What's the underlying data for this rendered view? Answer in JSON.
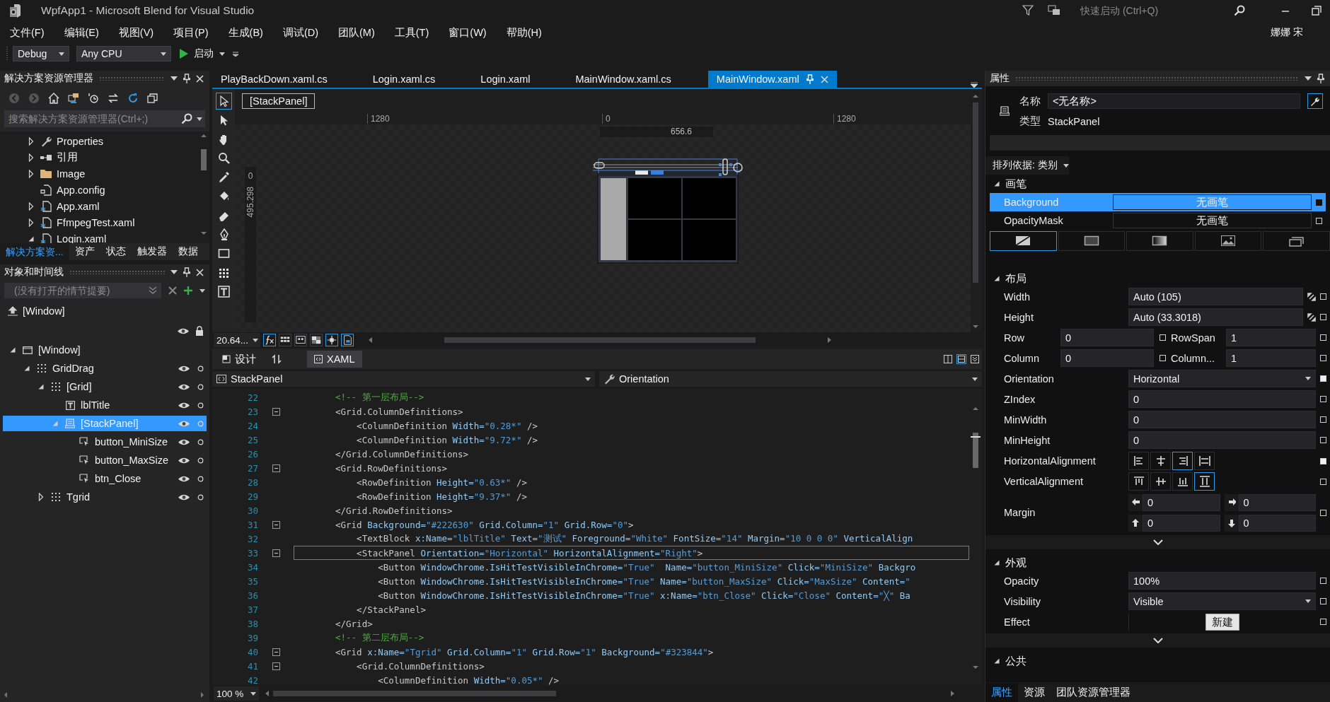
{
  "window": {
    "title": "WpfApp1 - Microsoft Blend for Visual Studio",
    "quick_launch": {
      "placeholder": "快速启动 (Ctrl+Q)"
    },
    "user": "娜娜 宋"
  },
  "menu": [
    "文件(F)",
    "编辑(E)",
    "视图(V)",
    "项目(P)",
    "生成(B)",
    "调试(D)",
    "团队(M)",
    "工具(T)",
    "窗口(W)",
    "帮助(H)"
  ],
  "toolbar": {
    "configuration": "Debug",
    "platform": "Any CPU",
    "start": "启动"
  },
  "solution_explorer": {
    "title": "解决方案资源管理器",
    "search": {
      "placeholder": "搜索解决方案资源管理器(Ctrl+;)"
    },
    "items": [
      {
        "label": "Properties",
        "kind": "wrench",
        "expanded": false
      },
      {
        "label": "引用",
        "kind": "references",
        "expanded": false
      },
      {
        "label": "Image",
        "kind": "folder",
        "expanded": false
      },
      {
        "label": "App.config",
        "kind": "config"
      },
      {
        "label": "App.xaml",
        "kind": "xaml",
        "expanded": false
      },
      {
        "label": "FfmpegTest.xaml",
        "kind": "xaml",
        "expanded": false
      },
      {
        "label": "Login.xaml",
        "kind": "xaml",
        "expanded": true
      }
    ],
    "tabs": [
      {
        "label": "解决方案资...",
        "selected": true
      },
      {
        "label": "资产",
        "selected": false
      },
      {
        "label": "状态",
        "selected": false
      },
      {
        "label": "触发器",
        "selected": false
      },
      {
        "label": "数据",
        "selected": false
      }
    ]
  },
  "objects": {
    "title": "对象和时间线",
    "storyboard": {
      "placeholder": "(没有打开的情节提要)"
    },
    "scope": "[Window]",
    "tree": [
      {
        "label": "[Window]",
        "kind": "window",
        "expanded": true,
        "selected": false,
        "children": [
          {
            "label": "GridDrag",
            "kind": "grid",
            "expanded": true,
            "selected": false,
            "children": [
              {
                "label": "[Grid]",
                "kind": "grid",
                "expanded": true,
                "selected": false,
                "children": [
                  {
                    "label": "lblTitle",
                    "kind": "text",
                    "selected": false
                  },
                  {
                    "label": "[StackPanel]",
                    "kind": "stack",
                    "expanded": true,
                    "selected": true,
                    "children": [
                      {
                        "label": "button_MiniSize",
                        "kind": "button",
                        "selected": false
                      },
                      {
                        "label": "button_MaxSize",
                        "kind": "button",
                        "selected": false
                      },
                      {
                        "label": "btn_Close",
                        "kind": "button",
                        "selected": false
                      }
                    ]
                  }
                ]
              },
              {
                "label": "Tgrid",
                "kind": "grid",
                "expanded": false,
                "selected": false
              }
            ]
          }
        ]
      }
    ]
  },
  "editor": {
    "tabs": [
      {
        "label": "PlayBackDown.xaml.cs",
        "selected": false
      },
      {
        "label": "Login.xaml.cs",
        "selected": false
      },
      {
        "label": "Login.xaml",
        "selected": false
      },
      {
        "label": "MainWindow.xaml.cs",
        "selected": false
      },
      {
        "label": "MainWindow.xaml",
        "selected": true
      }
    ],
    "designer": {
      "breadcrumb": "[StackPanel]",
      "ruler_labels": [
        "1280",
        "0",
        "1280"
      ],
      "width_readout": "656.6",
      "vertical_ruler_label": "0",
      "height_readout": "495.298",
      "zoom": "20.64..."
    },
    "view_tabs": [
      {
        "label": "设计",
        "selected": false
      },
      {
        "label": "XAML",
        "selected": true
      }
    ],
    "element_selector": "StackPanel",
    "member_selector": "Orientation",
    "code": {
      "zoom": "100 %",
      "lines": [
        {
          "number": "22",
          "fold": false,
          "current": false,
          "tokens": [
            {
              "kind": "comment",
              "text": "<!-- 第一层布局-->"
            }
          ]
        },
        {
          "number": "23",
          "fold": true,
          "current": false,
          "tokens": [
            {
              "kind": "tag",
              "text": "<Grid.ColumnDefinitions>"
            }
          ]
        },
        {
          "number": "24",
          "fold": false,
          "current": false,
          "tokens": [
            {
              "kind": "tag",
              "text": "    <ColumnDefinition"
            },
            {
              "kind": "attr",
              "text": " Width="
            },
            {
              "kind": "value",
              "text": "\"0.28*\""
            },
            {
              "kind": "tag",
              "text": " />"
            }
          ]
        },
        {
          "number": "25",
          "fold": false,
          "current": false,
          "tokens": [
            {
              "kind": "tag",
              "text": "    <ColumnDefinition"
            },
            {
              "kind": "attr",
              "text": " Width="
            },
            {
              "kind": "value",
              "text": "\"9.72*\""
            },
            {
              "kind": "tag",
              "text": " />"
            }
          ]
        },
        {
          "number": "26",
          "fold": false,
          "current": false,
          "tokens": [
            {
              "kind": "tag",
              "text": "</Grid.ColumnDefinitions>"
            }
          ]
        },
        {
          "number": "27",
          "fold": true,
          "current": false,
          "tokens": [
            {
              "kind": "tag",
              "text": "<Grid.RowDefinitions>"
            }
          ]
        },
        {
          "number": "28",
          "fold": false,
          "current": false,
          "tokens": [
            {
              "kind": "tag",
              "text": "    <RowDefinition"
            },
            {
              "kind": "attr",
              "text": " Height="
            },
            {
              "kind": "value",
              "text": "\"0.63*\""
            },
            {
              "kind": "tag",
              "text": " />"
            }
          ]
        },
        {
          "number": "29",
          "fold": false,
          "current": false,
          "tokens": [
            {
              "kind": "tag",
              "text": "    <RowDefinition"
            },
            {
              "kind": "attr",
              "text": " Height="
            },
            {
              "kind": "value",
              "text": "\"9.37*\""
            },
            {
              "kind": "tag",
              "text": " />"
            }
          ]
        },
        {
          "number": "30",
          "fold": false,
          "current": false,
          "tokens": [
            {
              "kind": "tag",
              "text": "</Grid.RowDefinitions>"
            }
          ]
        },
        {
          "number": "31",
          "fold": true,
          "current": false,
          "tokens": [
            {
              "kind": "tag",
              "text": "<Grid"
            },
            {
              "kind": "attr",
              "text": " Background="
            },
            {
              "kind": "value",
              "text": "\"#222630\""
            },
            {
              "kind": "attr",
              "text": " Grid.Column="
            },
            {
              "kind": "value",
              "text": "\"1\""
            },
            {
              "kind": "attr",
              "text": " Grid.Row="
            },
            {
              "kind": "value",
              "text": "\"0\""
            },
            {
              "kind": "tag",
              "text": ">"
            }
          ]
        },
        {
          "number": "32",
          "fold": false,
          "current": false,
          "tokens": [
            {
              "kind": "tag",
              "text": "    <TextBlock"
            },
            {
              "kind": "attr",
              "text": " x:Name="
            },
            {
              "kind": "value",
              "text": "\"lblTitle\""
            },
            {
              "kind": "attr",
              "text": " Text="
            },
            {
              "kind": "value",
              "text": "\"测试\""
            },
            {
              "kind": "attr",
              "text": " Foreground="
            },
            {
              "kind": "value",
              "text": "\"White\""
            },
            {
              "kind": "attr",
              "text": " FontSize="
            },
            {
              "kind": "value",
              "text": "\"14\""
            },
            {
              "kind": "attr",
              "text": " Margin="
            },
            {
              "kind": "value",
              "text": "\"10 0 0 0\""
            },
            {
              "kind": "attr",
              "text": " VerticalAlign"
            }
          ]
        },
        {
          "number": "33",
          "fold": true,
          "current": true,
          "tokens": [
            {
              "kind": "tag",
              "text": "    <StackPanel"
            },
            {
              "kind": "attr",
              "text": " Orientation="
            },
            {
              "kind": "value",
              "text": "\"Horizontal\""
            },
            {
              "kind": "attr",
              "text": " HorizontalAlignment="
            },
            {
              "kind": "value",
              "text": "\"Right\""
            },
            {
              "kind": "tag",
              "text": ">"
            }
          ]
        },
        {
          "number": "34",
          "fold": false,
          "current": false,
          "tokens": [
            {
              "kind": "tag",
              "text": "        <Button"
            },
            {
              "kind": "attr",
              "text": " WindowChrome.IsHitTestVisibleInChrome="
            },
            {
              "kind": "value",
              "text": "\"True\""
            },
            {
              "kind": "attr",
              "text": "  Name="
            },
            {
              "kind": "value",
              "text": "\"button_MiniSize\""
            },
            {
              "kind": "attr",
              "text": " Click="
            },
            {
              "kind": "value",
              "text": "\"MiniSize\""
            },
            {
              "kind": "attr",
              "text": " Backgro"
            }
          ]
        },
        {
          "number": "35",
          "fold": false,
          "current": false,
          "tokens": [
            {
              "kind": "tag",
              "text": "        <Button"
            },
            {
              "kind": "attr",
              "text": " WindowChrome.IsHitTestVisibleInChrome="
            },
            {
              "kind": "value",
              "text": "\"True\""
            },
            {
              "kind": "attr",
              "text": " Name="
            },
            {
              "kind": "value",
              "text": "\"button_MaxSize\""
            },
            {
              "kind": "attr",
              "text": " Click="
            },
            {
              "kind": "value",
              "text": "\"MaxSize\""
            },
            {
              "kind": "attr",
              "text": " Content="
            },
            {
              "kind": "value",
              "text": "\""
            }
          ]
        },
        {
          "number": "36",
          "fold": false,
          "current": false,
          "tokens": [
            {
              "kind": "tag",
              "text": "        <Button"
            },
            {
              "kind": "attr",
              "text": " WindowChrome.IsHitTestVisibleInChrome="
            },
            {
              "kind": "value",
              "text": "\"True\""
            },
            {
              "kind": "attr",
              "text": " x:Name="
            },
            {
              "kind": "value",
              "text": "\"btn_Close\""
            },
            {
              "kind": "attr",
              "text": " Click="
            },
            {
              "kind": "value",
              "text": "\"Close\""
            },
            {
              "kind": "attr",
              "text": " Content="
            },
            {
              "kind": "value",
              "text": "\"╳\""
            },
            {
              "kind": "attr",
              "text": " Ba"
            }
          ]
        },
        {
          "number": "37",
          "fold": false,
          "current": false,
          "tokens": [
            {
              "kind": "tag",
              "text": "    </StackPanel>"
            }
          ]
        },
        {
          "number": "38",
          "fold": false,
          "current": false,
          "tokens": [
            {
              "kind": "tag",
              "text": "</Grid>"
            }
          ]
        },
        {
          "number": "39",
          "fold": false,
          "current": false,
          "tokens": [
            {
              "kind": "comment",
              "text": "<!-- 第二层布局-->"
            }
          ]
        },
        {
          "number": "40",
          "fold": true,
          "current": false,
          "tokens": [
            {
              "kind": "tag",
              "text": "<Grid"
            },
            {
              "kind": "attr",
              "text": " x:Name="
            },
            {
              "kind": "value",
              "text": "\"Tgrid\""
            },
            {
              "kind": "attr",
              "text": " Grid.Column="
            },
            {
              "kind": "value",
              "text": "\"1\""
            },
            {
              "kind": "attr",
              "text": " Grid.Row="
            },
            {
              "kind": "value",
              "text": "\"1\""
            },
            {
              "kind": "attr",
              "text": " Background="
            },
            {
              "kind": "value",
              "text": "\"#323844\""
            },
            {
              "kind": "tag",
              "text": ">"
            }
          ]
        },
        {
          "number": "41",
          "fold": true,
          "current": false,
          "tokens": [
            {
              "kind": "tag",
              "text": "    <Grid.ColumnDefinitions>"
            }
          ]
        },
        {
          "number": "42",
          "fold": false,
          "current": false,
          "tokens": [
            {
              "kind": "tag",
              "text": "        <ColumnDefinition"
            },
            {
              "kind": "attr",
              "text": " Width="
            },
            {
              "kind": "value",
              "text": "\"0.05*\""
            },
            {
              "kind": "tag",
              "text": " />"
            }
          ]
        }
      ]
    }
  },
  "properties": {
    "title": "属性",
    "name_label": "名称",
    "name_value": "<无名称>",
    "type_label": "类型",
    "type_value": "StackPanel",
    "sort": "排列依据: 类别",
    "sections": [
      {
        "title": "画笔",
        "expanded": true,
        "advanced": false,
        "rows": [
          {
            "kind": "brush",
            "label": "Background",
            "value": "无画笔",
            "selected": true,
            "local": true
          },
          {
            "kind": "brush",
            "label": "OpacityMask",
            "value": "无画笔",
            "selected": false,
            "local": false
          },
          {
            "kind": "brush_types",
            "options": [
              {
                "selected": true
              },
              {
                "selected": false
              },
              {
                "selected": false
              },
              {
                "selected": false
              },
              {
                "selected": false
              }
            ]
          }
        ]
      },
      {
        "title": "布局",
        "expanded": true,
        "advanced": true,
        "rows": [
          {
            "kind": "size",
            "label": "Width",
            "value": "Auto (105)",
            "local": false
          },
          {
            "kind": "size",
            "label": "Height",
            "value": "Auto (33.3018)",
            "local": false
          },
          {
            "kind": "pair",
            "cells": [
              {
                "label": "Row",
                "value": "0",
                "local": false
              },
              {
                "label": "RowSpan",
                "value": "1",
                "local": false
              }
            ]
          },
          {
            "kind": "pair",
            "cells": [
              {
                "label": "Column",
                "value": "0",
                "local": false
              },
              {
                "label": "Column...",
                "value": "1",
                "local": false
              }
            ]
          },
          {
            "kind": "combo",
            "label": "Orientation",
            "value": "Horizontal",
            "local": true
          },
          {
            "kind": "text",
            "label": "ZIndex",
            "value": "0",
            "local": false
          },
          {
            "kind": "text",
            "label": "MinWidth",
            "value": "0",
            "local": false
          },
          {
            "kind": "text",
            "label": "MinHeight",
            "value": "0",
            "local": false
          },
          {
            "kind": "halign",
            "label": "HorizontalAlignment",
            "local": true,
            "options": [
              {
                "selected": false
              },
              {
                "selected": false
              },
              {
                "selected": true
              },
              {
                "selected": false
              }
            ]
          },
          {
            "kind": "valign",
            "label": "VerticalAlignment",
            "local": false,
            "options": [
              {
                "selected": false
              },
              {
                "selected": false
              },
              {
                "selected": false
              },
              {
                "selected": true
              }
            ]
          },
          {
            "kind": "margin",
            "label": "Margin",
            "values": [
              "0",
              "0",
              "0",
              "0"
            ],
            "local": false
          }
        ]
      },
      {
        "title": "外观",
        "expanded": true,
        "advanced": true,
        "rows": [
          {
            "kind": "text",
            "label": "Opacity",
            "value": "100%",
            "local": false
          },
          {
            "kind": "combo",
            "label": "Visibility",
            "value": "Visible",
            "local": false
          },
          {
            "kind": "button",
            "label": "Effect",
            "button": "新建",
            "local": false
          }
        ]
      },
      {
        "title": "公共",
        "expanded": true,
        "advanced": false
      }
    ],
    "bottom_tabs": [
      {
        "label": "属性",
        "selected": true
      },
      {
        "label": "资源",
        "selected": false
      },
      {
        "label": "团队资源管理器",
        "selected": false
      }
    ]
  }
}
